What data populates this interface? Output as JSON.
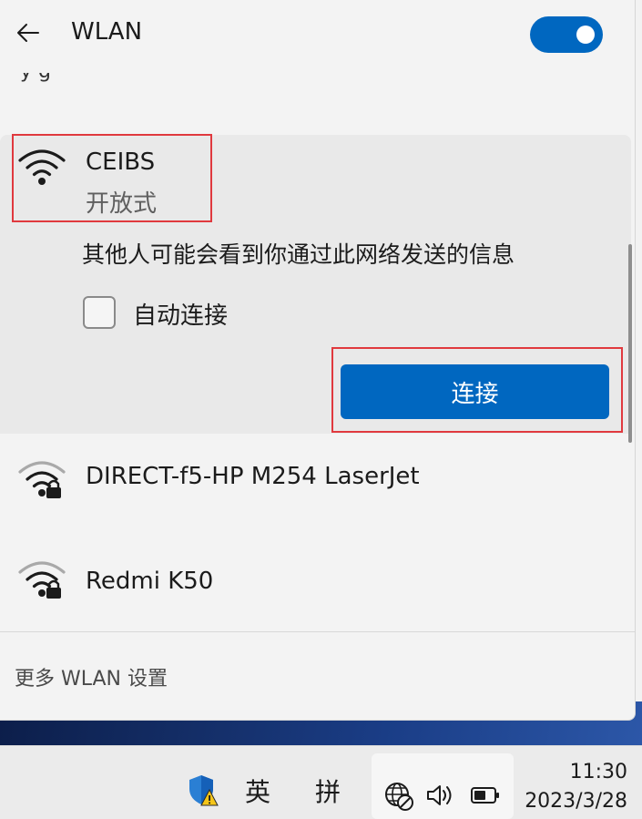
{
  "header": {
    "title": "WLAN"
  },
  "clipped_text": "y                                g",
  "networks": [
    {
      "name": "CEIBS",
      "status": "开放式",
      "secured": false,
      "expanded": true
    },
    {
      "name": "DIRECT-f5-HP M254 LaserJet",
      "secured": true
    },
    {
      "name": "Redmi K50",
      "secured": true
    }
  ],
  "expanded_panel": {
    "info_text": "其他人可能会看到你通过此网络发送的信息",
    "auto_connect_label": "自动连接",
    "auto_connect_checked": false,
    "connect_label": "连接"
  },
  "footer": {
    "more_settings": "更多 WLAN 设置"
  },
  "taskbar": {
    "ime_lang": "英",
    "ime_mode": "拼",
    "time": "11:30",
    "date": "2023/3/28"
  },
  "colors": {
    "accent": "#0067c0",
    "highlight": "#e0393e"
  }
}
